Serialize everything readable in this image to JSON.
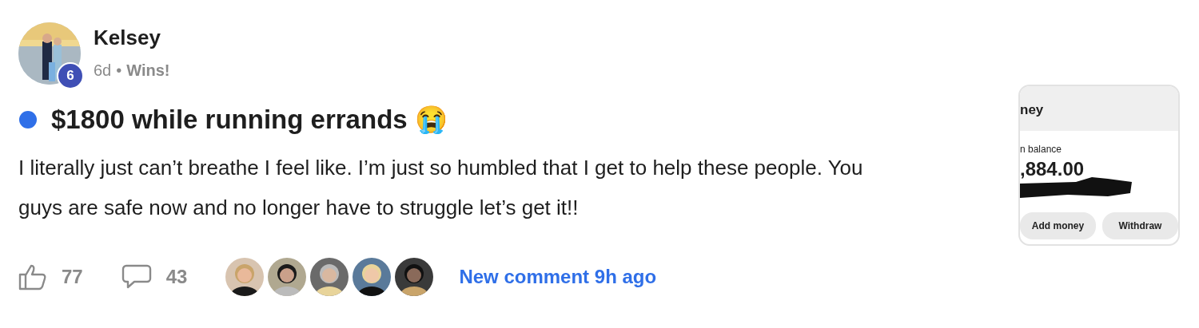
{
  "author": {
    "name": "Kelsey",
    "badge": "6",
    "age": "6d",
    "separator": "•",
    "category": "Wins!"
  },
  "post": {
    "unread": true,
    "title": "$1800 while running errands 😭",
    "body": "I literally just can’t breathe I feel like. I’m just so humbled that I get to help these people. You guys are safe now and no longer have to struggle let’s get it!!"
  },
  "attachment": {
    "header": "ney",
    "balance_label": "n balance",
    "balance": ",884.00",
    "buttons": [
      "Add money",
      "Withdraw"
    ]
  },
  "footer": {
    "likes": "77",
    "comments": "43",
    "new_comment": "New comment 9h ago"
  }
}
